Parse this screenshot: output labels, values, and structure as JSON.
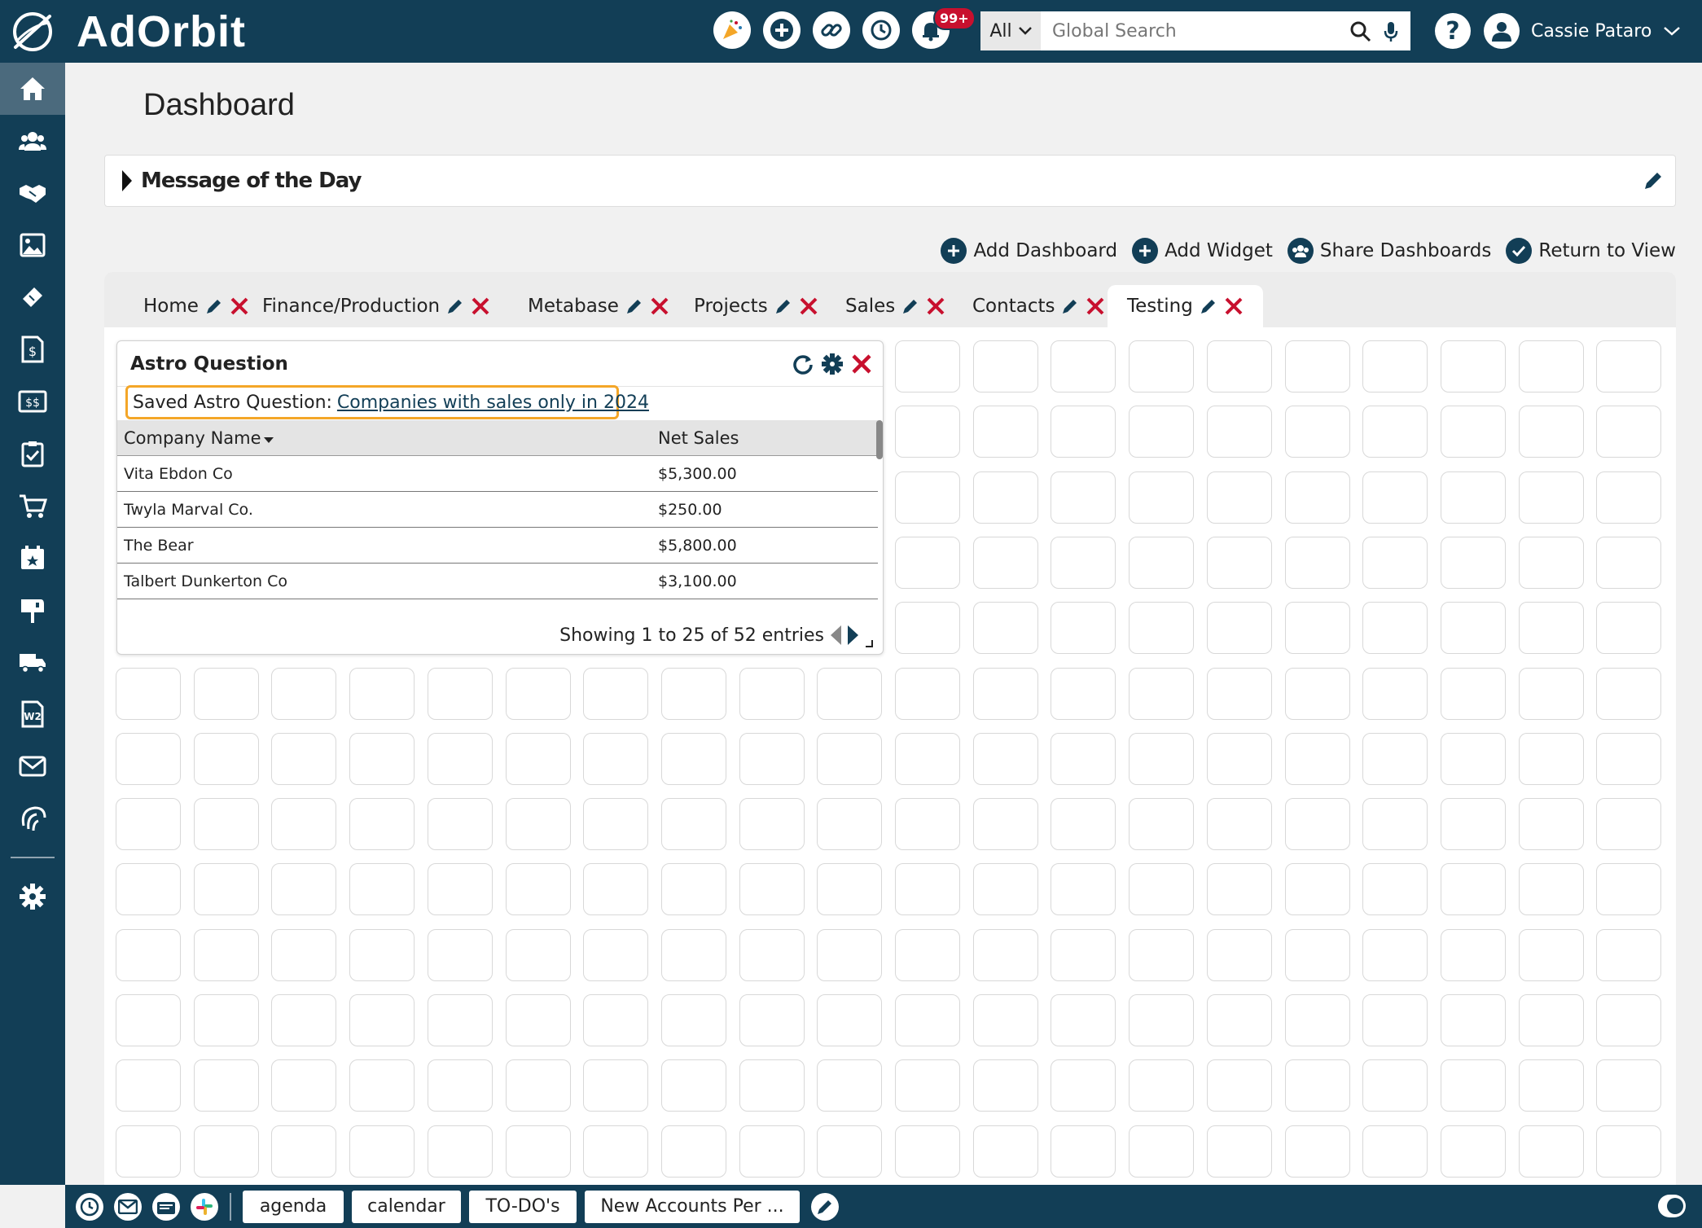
{
  "brand": {
    "name": "AdOrbit"
  },
  "topbar": {
    "notifications_badge": "99+",
    "search_scope": "All",
    "search_placeholder": "Global Search",
    "help_label": "?",
    "user_name": "Cassie Pataro"
  },
  "sidebar": {
    "items": [
      "home-icon",
      "contacts-icon",
      "deals-icon",
      "gallery-icon",
      "ticket-icon",
      "invoice-icon",
      "payments-icon",
      "tasks-icon",
      "cart-icon",
      "calendar-icon",
      "mailbox-icon",
      "delivery-icon",
      "w2-icon",
      "mail-icon",
      "orbit-icon"
    ],
    "settings": "gear-icon"
  },
  "page": {
    "title": "Dashboard"
  },
  "motd": {
    "title": "Message of the Day"
  },
  "dash_actions": {
    "add_dashboard": "Add Dashboard",
    "add_widget": "Add Widget",
    "share_dashboards": "Share Dashboards",
    "return_to_view": "Return to View"
  },
  "tabs": [
    {
      "label": "Home"
    },
    {
      "label": "Finance/Production"
    },
    {
      "label": "Metabase"
    },
    {
      "label": "Projects"
    },
    {
      "label": "Sales"
    },
    {
      "label": "Contacts"
    },
    {
      "label": "Testing",
      "active": true
    }
  ],
  "widget": {
    "title": "Astro Question",
    "saved_label": "Saved Astro Question:",
    "saved_link": "Companies with sales only in 2024",
    "columns": [
      "Company Name",
      "Net Sales"
    ],
    "rows": [
      [
        "Vita Ebdon Co",
        "$5,300.00"
      ],
      [
        "Twyla Marval Co.",
        "$250.00"
      ],
      [
        "The Bear",
        "$5,800.00"
      ],
      [
        "Talbert Dunkerton Co",
        "$3,100.00"
      ]
    ],
    "footer": "Showing 1 to 25 of 52 entries"
  },
  "bottombar": {
    "tabs": [
      "agenda",
      "calendar",
      "TO-DO's",
      "New Accounts Per ..."
    ]
  },
  "colors": {
    "navy": "#123e56",
    "red": "#c8102e",
    "highlight": "#f4a628"
  }
}
